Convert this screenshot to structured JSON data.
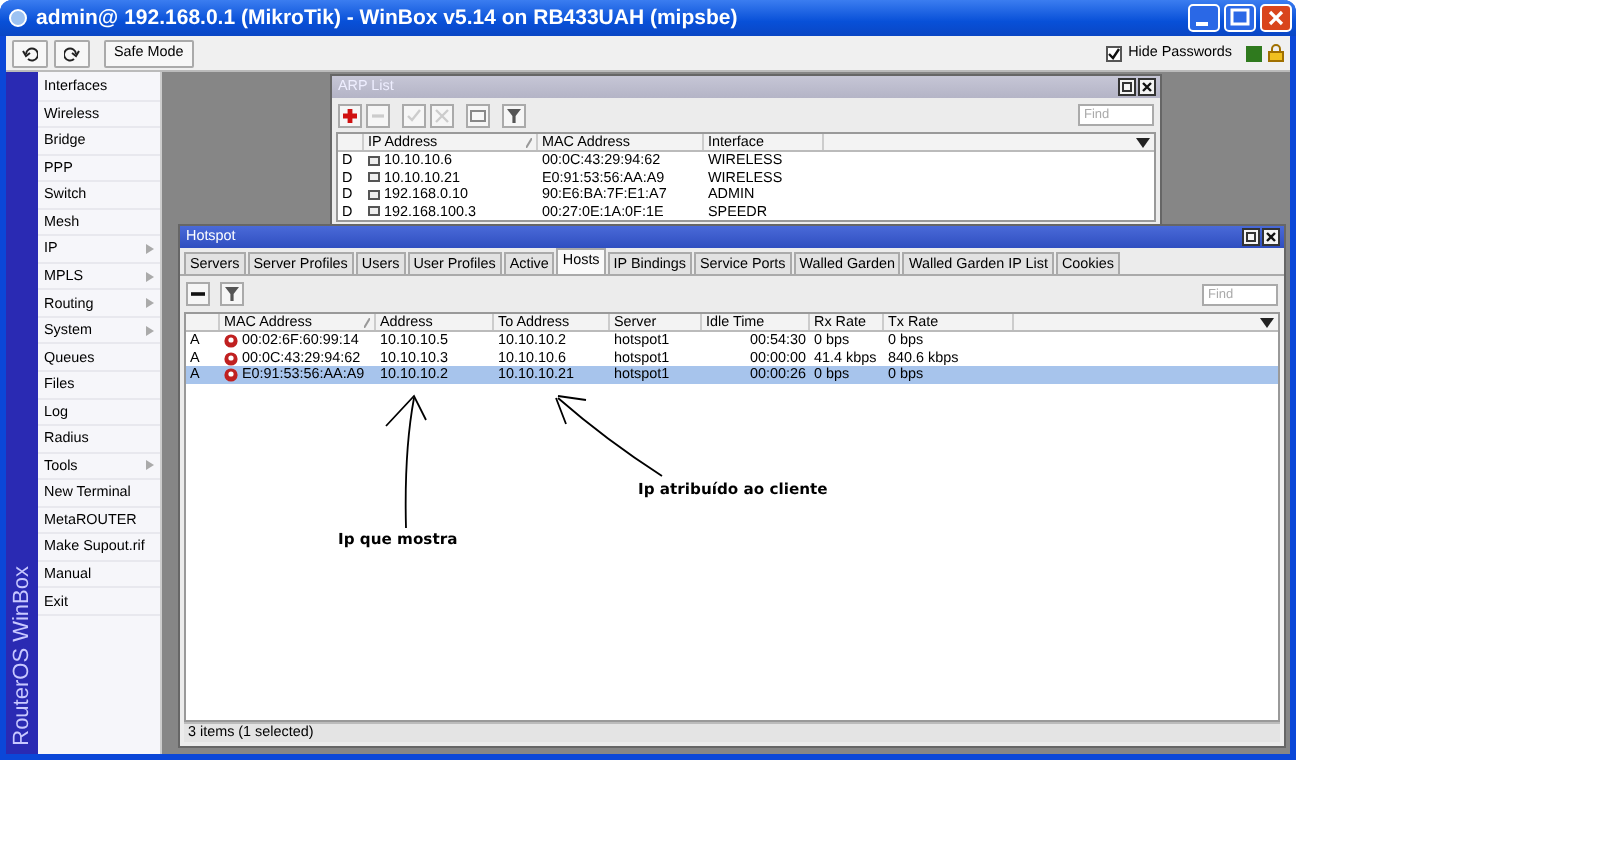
{
  "window": {
    "title": "admin@ 192.168.0.1 (MikroTik) - WinBox v5.14 on RB433UAH (mipsbe)"
  },
  "toolbar": {
    "safe_mode": "Safe Mode",
    "hide_passwords": {
      "label": "Hide Passwords",
      "checked": true
    }
  },
  "sidebar": {
    "brand": "RouterOS WinBox",
    "items": [
      {
        "label": "Interfaces",
        "submenu": false
      },
      {
        "label": "Wireless",
        "submenu": false
      },
      {
        "label": "Bridge",
        "submenu": false
      },
      {
        "label": "PPP",
        "submenu": false
      },
      {
        "label": "Switch",
        "submenu": false
      },
      {
        "label": "Mesh",
        "submenu": false
      },
      {
        "label": "IP",
        "submenu": true
      },
      {
        "label": "MPLS",
        "submenu": true
      },
      {
        "label": "Routing",
        "submenu": true
      },
      {
        "label": "System",
        "submenu": true
      },
      {
        "label": "Queues",
        "submenu": false
      },
      {
        "label": "Files",
        "submenu": false
      },
      {
        "label": "Log",
        "submenu": false
      },
      {
        "label": "Radius",
        "submenu": false
      },
      {
        "label": "Tools",
        "submenu": true
      },
      {
        "label": "New Terminal",
        "submenu": false
      },
      {
        "label": "MetaROUTER",
        "submenu": false
      },
      {
        "label": "Make Supout.rif",
        "submenu": false
      },
      {
        "label": "Manual",
        "submenu": false
      },
      {
        "label": "Exit",
        "submenu": false
      }
    ]
  },
  "arp_window": {
    "title": "ARP List",
    "find_placeholder": "Find",
    "columns": [
      "IP Address",
      "MAC Address",
      "Interface"
    ],
    "rows": [
      {
        "flag": "D",
        "cells": [
          "10.10.10.6",
          "00:0C:43:29:94:62",
          "WIRELESS"
        ]
      },
      {
        "flag": "D",
        "cells": [
          "10.10.10.21",
          "E0:91:53:56:AA:A9",
          "WIRELESS"
        ]
      },
      {
        "flag": "D",
        "cells": [
          "192.168.0.10",
          "90:E6:BA:7F:E1:A7",
          "ADMIN"
        ]
      },
      {
        "flag": "D",
        "cells": [
          "192.168.100.3",
          "00:27:0E:1A:0F:1E",
          "SPEEDR"
        ]
      }
    ]
  },
  "hotspot_window": {
    "title": "Hotspot",
    "tabs": [
      {
        "label": "Servers",
        "selected": false
      },
      {
        "label": "Server Profiles",
        "selected": false
      },
      {
        "label": "Users",
        "selected": false
      },
      {
        "label": "User Profiles",
        "selected": false
      },
      {
        "label": "Active",
        "selected": false
      },
      {
        "label": "Hosts",
        "selected": true
      },
      {
        "label": "IP Bindings",
        "selected": false
      },
      {
        "label": "Service Ports",
        "selected": false
      },
      {
        "label": "Walled Garden",
        "selected": false
      },
      {
        "label": "Walled Garden IP List",
        "selected": false
      },
      {
        "label": "Cookies",
        "selected": false
      }
    ],
    "find_placeholder": "Find",
    "columns": [
      "MAC Address",
      "Address",
      "To Address",
      "Server",
      "Idle Time",
      "Rx Rate",
      "Tx Rate"
    ],
    "rows": [
      {
        "flag": "A",
        "selected": false,
        "cells": [
          "00:02:6F:60:99:14",
          "10.10.10.5",
          "10.10.10.2",
          "hotspot1",
          "00:54:30",
          "0 bps",
          "0 bps"
        ]
      },
      {
        "flag": "A",
        "selected": false,
        "cells": [
          "00:0C:43:29:94:62",
          "10.10.10.3",
          "10.10.10.6",
          "hotspot1",
          "00:00:00",
          "41.4 kbps",
          "840.6 kbps"
        ]
      },
      {
        "flag": "A",
        "selected": true,
        "cells": [
          "E0:91:53:56:AA:A9",
          "10.10.10.2",
          "10.10.10.21",
          "hotspot1",
          "00:00:26",
          "0 bps",
          "0 bps"
        ]
      }
    ],
    "status": "3 items (1 selected)"
  },
  "annotations": [
    {
      "text": "Ip que mostra"
    },
    {
      "text": "Ip atribuído ao cliente"
    }
  ]
}
